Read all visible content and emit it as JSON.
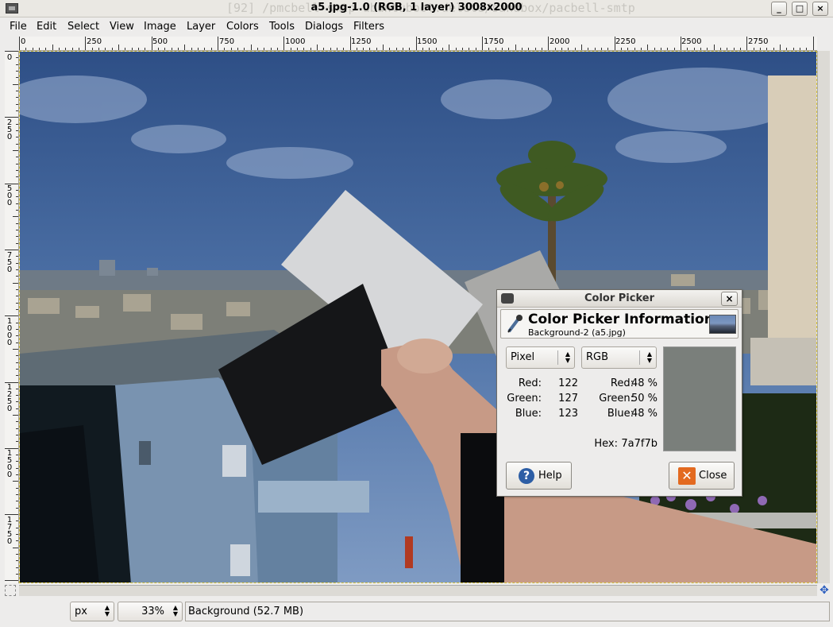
{
  "window": {
    "title": "a5.jpg-1.0 (RGB, 1 layer) 3008x2000",
    "ghost_text": "[92] /pmcbell-smtp-ubuntuboot.delete/sandbox/pacbell-smtp",
    "minimize": "_",
    "maximize": "□",
    "close": "×"
  },
  "menu": [
    {
      "label": "File",
      "mnemonic": "F"
    },
    {
      "label": "Edit",
      "mnemonic": "E"
    },
    {
      "label": "Select",
      "mnemonic": "S"
    },
    {
      "label": "View",
      "mnemonic": "V"
    },
    {
      "label": "Image",
      "mnemonic": "I"
    },
    {
      "label": "Layer",
      "mnemonic": "L"
    },
    {
      "label": "Colors",
      "mnemonic": "C"
    },
    {
      "label": "Tools",
      "mnemonic": "T"
    },
    {
      "label": "Dialogs",
      "mnemonic": "D"
    },
    {
      "label": "Filters",
      "mnemonic": "r"
    }
  ],
  "ruler": {
    "top": [
      "0",
      "250",
      "500",
      "750",
      "1000",
      "1250",
      "1500",
      "1750",
      "2000",
      "2250",
      "2500",
      "2750"
    ],
    "left": [
      "0",
      "250",
      "500",
      "750",
      "1000",
      "1250",
      "1500",
      "1750"
    ]
  },
  "status": {
    "unit": "px",
    "zoom": "33%",
    "text": "Background (52.7 MB)"
  },
  "dialog": {
    "title": "Color Picker",
    "close": "×",
    "heading": "Color Picker Information",
    "subheading": "Background-2 (a5.jpg)",
    "mode_left": "Pixel",
    "mode_right": "RGB",
    "pixel": [
      {
        "label": "Red:",
        "value": "122"
      },
      {
        "label": "Green:",
        "value": "127"
      },
      {
        "label": "Blue:",
        "value": "123"
      }
    ],
    "rgb": [
      {
        "label": "Red:",
        "value": "48 %"
      },
      {
        "label": "Green:",
        "value": "50 %"
      },
      {
        "label": "Blue:",
        "value": "48 %"
      }
    ],
    "hex_label": "Hex:",
    "hex_value": "7a7f7b",
    "swatch_color": "#7a7f7b",
    "help_label": "Help",
    "close_label": "Close"
  }
}
